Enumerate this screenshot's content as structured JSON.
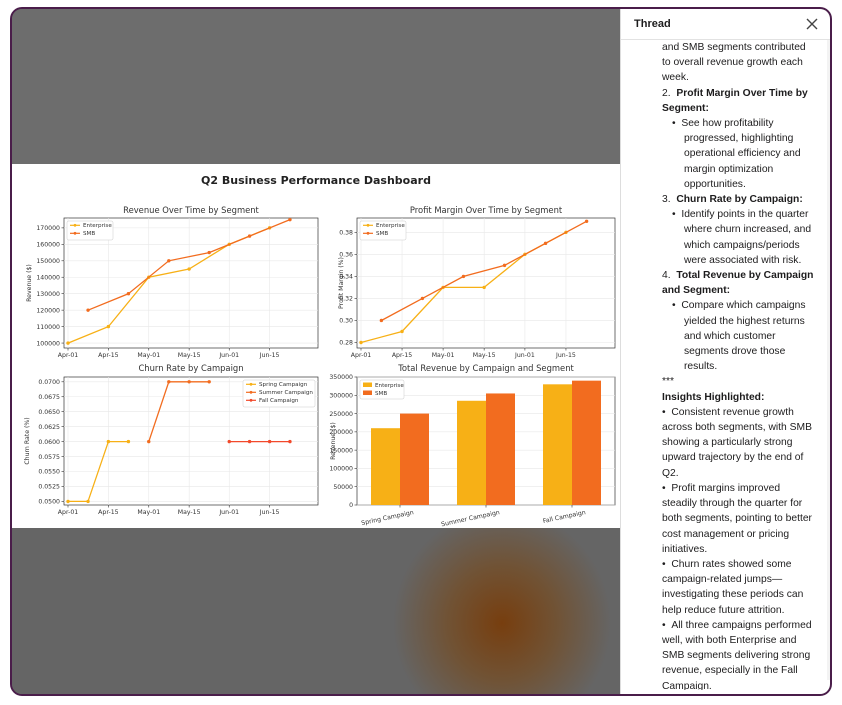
{
  "thread": {
    "title": "Thread",
    "close_icon": "close-icon",
    "intro_cont": "and SMB segments contributed to overall revenue growth each week.",
    "items": [
      {
        "num": "2.",
        "title": "Profit Margin Over Time by Segment:",
        "bullet": "See how profitability progressed, highlighting operational efficiency and margin optimization opportunities."
      },
      {
        "num": "3.",
        "title": "Churn Rate by Campaign:",
        "bullet": "Identify points in the quarter where churn increased, and which campaigns/periods were associated with risk."
      },
      {
        "num": "4.",
        "title": "Total Revenue by Campaign and Segment:",
        "bullet": "Compare which campaigns yielded the highest returns and which customer segments drove those results."
      }
    ],
    "separator": "***",
    "insights_title": "Insights Highlighted:",
    "insights": [
      "Consistent revenue growth across both segments, with SMB showing a particularly strong upward trajectory by the end of Q2.",
      "Profit margins improved steadily through the quarter for both segments, pointing to better cost management or pricing initiatives.",
      "Churn rates showed some campaign-related jumps—investigating these periods can help reduce future attrition.",
      "All three campaigns performed well, with both Enterprise and SMB segments delivering strong revenue, especially in the Fall Campaign."
    ]
  },
  "dashboard": {
    "title": "Q2 Business Performance Dashboard"
  },
  "colors": {
    "enterprise": "#f7b016",
    "smb": "#f26c1f",
    "frame_border": "#4a1d4a"
  },
  "chart_data": [
    {
      "type": "line",
      "title": "Revenue Over Time by Segment",
      "xlabel": "",
      "ylabel": "Revenue ($)",
      "x_ticks": [
        "Apr-01",
        "Apr-15",
        "May-01",
        "May-15",
        "Jun-01",
        "Jun-15"
      ],
      "y_ticks": [
        "100000",
        "110000",
        "120000",
        "130000",
        "140000",
        "150000",
        "160000",
        "170000"
      ],
      "ylim": [
        97000,
        176000
      ],
      "xlim": [
        0,
        100
      ],
      "legend": "top-left",
      "series": [
        {
          "name": "Enterprise",
          "x": [
            0,
            14.3,
            28.6,
            42.9,
            57.1,
            71.4
          ],
          "y": [
            100000,
            110000,
            140000,
            145000,
            160000,
            170000
          ]
        },
        {
          "name": "SMB",
          "x": [
            7.1,
            21.4,
            35.7,
            50,
            64.3,
            78.6
          ],
          "y": [
            120000,
            130000,
            150000,
            155000,
            165000,
            175000
          ]
        }
      ]
    },
    {
      "type": "line",
      "title": "Profit Margin Over Time by Segment",
      "xlabel": "",
      "ylabel": "Profit Margin (%)",
      "x_ticks": [
        "Apr-01",
        "Apr-15",
        "May-01",
        "May-15",
        "Jun-01",
        "Jun-15"
      ],
      "y_ticks": [
        "0.28",
        "0.30",
        "0.32",
        "0.34",
        "0.36",
        "0.38"
      ],
      "ylim": [
        0.275,
        0.393
      ],
      "xlim": [
        0,
        100
      ],
      "legend": "top-left",
      "series": [
        {
          "name": "Enterprise",
          "x": [
            0,
            14.3,
            28.6,
            42.9,
            57.1,
            71.4
          ],
          "y": [
            0.28,
            0.29,
            0.33,
            0.33,
            0.36,
            0.38
          ]
        },
        {
          "name": "SMB",
          "x": [
            7.1,
            21.4,
            35.7,
            50,
            64.3,
            78.6
          ],
          "y": [
            0.3,
            0.32,
            0.34,
            0.35,
            0.37,
            0.39
          ]
        }
      ]
    },
    {
      "type": "line",
      "title": "Churn Rate by Campaign",
      "xlabel": "",
      "ylabel": "Churn Rate (%)",
      "x_ticks": [
        "Apr-01",
        "Apr-15",
        "May-01",
        "May-15",
        "Jun-01",
        "Jun-15"
      ],
      "y_ticks": [
        "0.0500",
        "0.0525",
        "0.0550",
        "0.0575",
        "0.0600",
        "0.0625",
        "0.0650",
        "0.0675",
        "0.0700"
      ],
      "ylim": [
        0.0494,
        0.0708
      ],
      "xlim": [
        0,
        100
      ],
      "legend": "top-right",
      "series": [
        {
          "name": "Spring Campaign",
          "x": [
            0,
            7.1,
            14.3,
            21.4
          ],
          "y": [
            0.05,
            0.05,
            0.06,
            0.06
          ]
        },
        {
          "name": "Summer Campaign",
          "x": [
            28.6,
            35.7,
            42.9,
            50
          ],
          "y": [
            0.06,
            0.07,
            0.07,
            0.07
          ]
        },
        {
          "name": "Fall Campaign",
          "x": [
            57.1,
            64.3,
            71.4,
            78.6
          ],
          "y": [
            0.06,
            0.06,
            0.06,
            0.06
          ]
        }
      ]
    },
    {
      "type": "bar",
      "title": "Total Revenue by Campaign and Segment",
      "xlabel": "",
      "ylabel": "Revenue ($)",
      "categories": [
        "Spring Campaign",
        "Summer Campaign",
        "Fall Campaign"
      ],
      "y_ticks": [
        "0",
        "50000",
        "100000",
        "150000",
        "200000",
        "250000",
        "300000",
        "350000"
      ],
      "ylim": [
        0,
        350000
      ],
      "legend": "top-left",
      "series": [
        {
          "name": "Enterprise",
          "values": [
            210000,
            285000,
            330000
          ]
        },
        {
          "name": "SMB",
          "values": [
            250000,
            305000,
            340000
          ]
        }
      ]
    }
  ]
}
